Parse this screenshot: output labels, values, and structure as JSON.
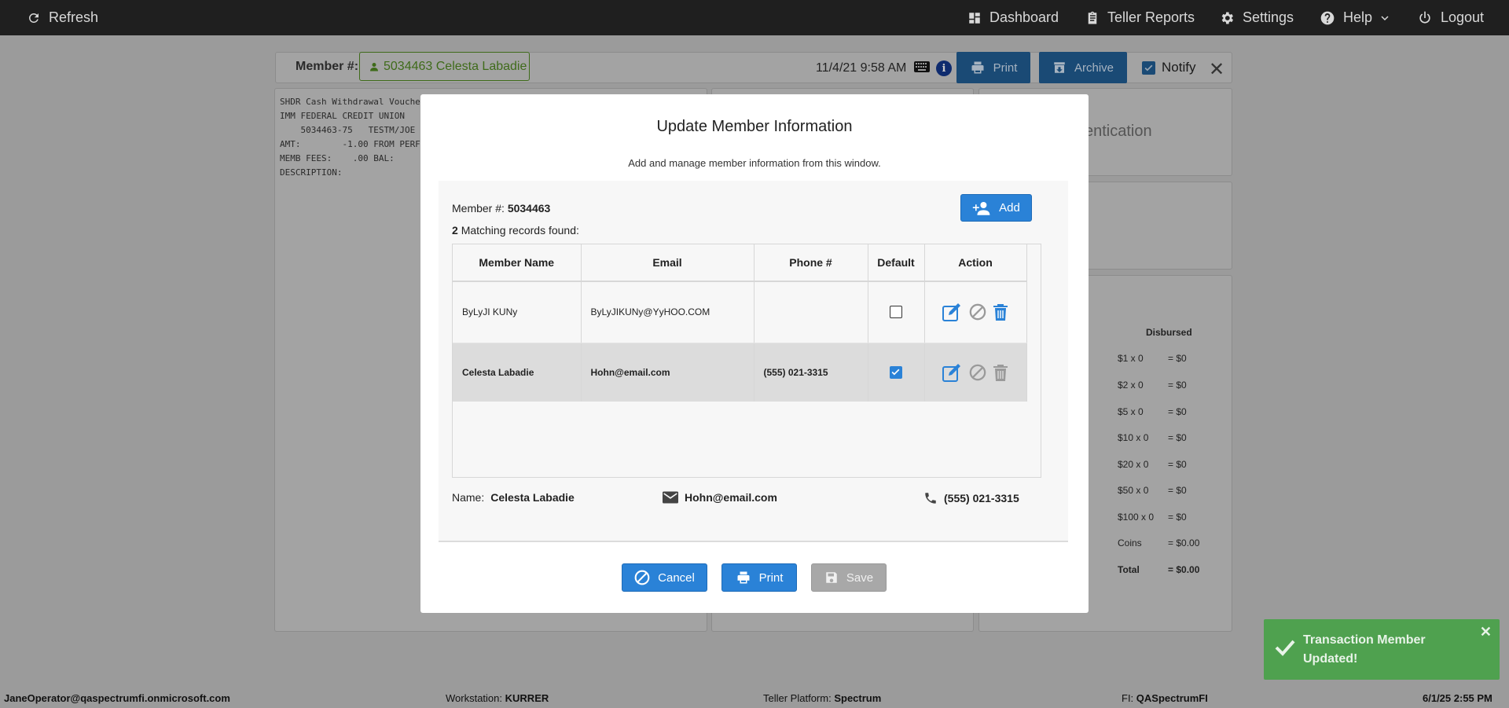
{
  "topbar": {
    "refresh": "Refresh",
    "dashboard": "Dashboard",
    "teller_reports": "Teller Reports",
    "settings": "Settings",
    "help": "Help",
    "logout": "Logout"
  },
  "background": {
    "member_label": "Member #:",
    "member_chip": "5034463 Celesta Labadie",
    "datetime": "11/4/21 9:58 AM",
    "print_label": "Print",
    "archive_label": "Archive",
    "notify_label": "Notify",
    "receipt_lines": [
      "SHDR Cash Withdrawal Voucher",
      "IMM FEDERAL CREDIT UNION",
      "    5034463-75   TESTM/JOE",
      "AMT:        -1.00 FROM PERF",
      "MEMB FEES:    .00 BAL:",
      "DESCRIPTION:"
    ],
    "auth_text": "entication",
    "disbursed_header": "Disbursed",
    "disbursed_rows": [
      {
        "label": "$1 x 0",
        "value": "= $0"
      },
      {
        "label": "$2 x 0",
        "value": "= $0"
      },
      {
        "label": "$5 x 0",
        "value": "= $0"
      },
      {
        "label": "$10 x 0",
        "value": "= $0"
      },
      {
        "label": "$20 x 0",
        "value": "= $0"
      },
      {
        "label": "$50 x 0",
        "value": "= $0"
      },
      {
        "label": "$100 x 0",
        "value": "= $0"
      },
      {
        "label": "Coins",
        "value": "= $0.00"
      },
      {
        "label": "Total",
        "value": "= $0.00"
      }
    ]
  },
  "modal": {
    "title": "Update Member Information",
    "subtitle": "Add and manage member information from this window.",
    "member_num_label": "Member #:",
    "member_num": "5034463",
    "match_count": "2",
    "match_text": "Matching records found:",
    "add_label": "Add",
    "columns": [
      "Member Name",
      "Email",
      "Phone #",
      "Default",
      "Action"
    ],
    "rows": [
      {
        "name": "ByLyJI KUNy",
        "email": "ByLyJIKUNy@YyHOO.COM",
        "phone": "",
        "default": false
      },
      {
        "name": "Celesta Labadie",
        "email": "Hohn@email.com",
        "phone": "(555) 021-3315",
        "default": true
      }
    ],
    "summary": {
      "name_label": "Name:",
      "name": "Celesta Labadie",
      "email": "Hohn@email.com",
      "phone": "(555) 021-3315"
    },
    "cancel_label": "Cancel",
    "print_label": "Print",
    "save_label": "Save"
  },
  "toast": {
    "message": "Transaction Member Updated!",
    "color": "#4fa14f"
  },
  "footer": {
    "user": "JaneOperator@qaspectrumfi.onmicrosoft.com",
    "workstation_label": "Workstation:",
    "workstation": "KURRER",
    "platform_label": "Teller Platform:",
    "platform": "Spectrum",
    "fi_label": "FI:",
    "fi": "QASpectrumFI",
    "datetime": "6/1/25 2:55 PM"
  },
  "colors": {
    "accent": "#2a82d7",
    "topbar": "#1f1f1f",
    "success": "#4fa14f"
  }
}
